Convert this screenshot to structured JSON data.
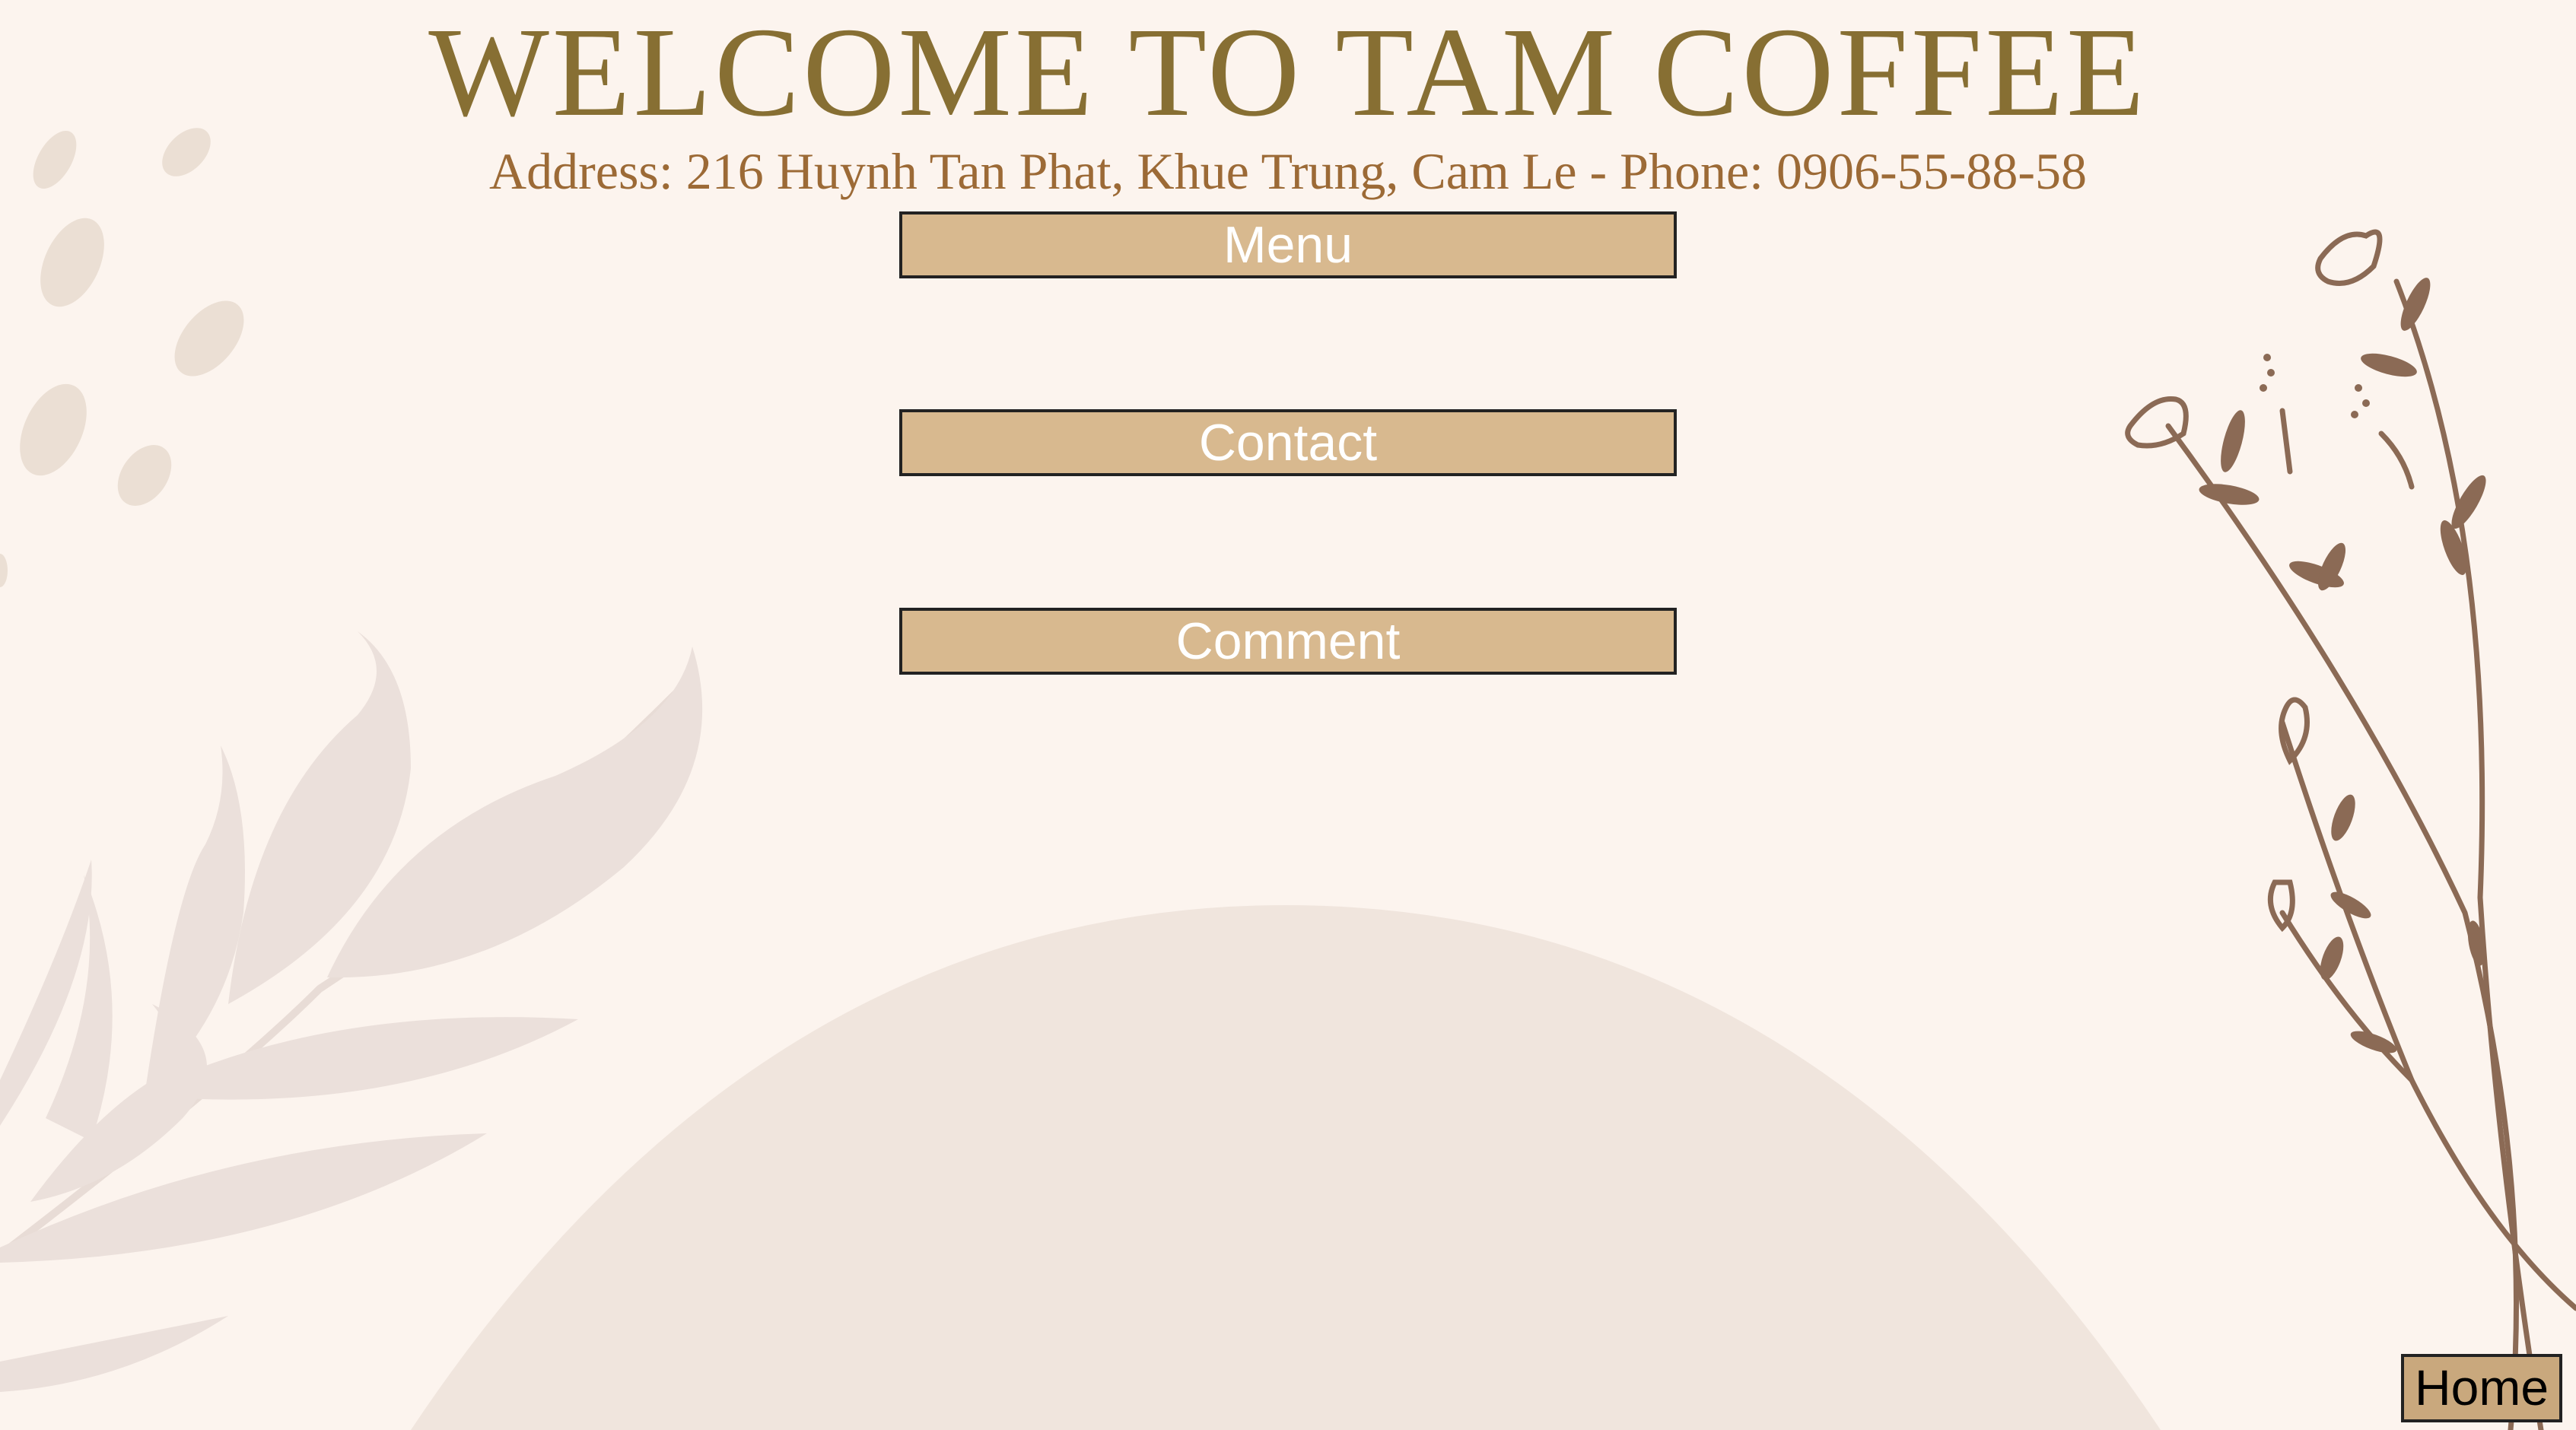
{
  "header": {
    "title": "WELCOME TO TAM COFFEE",
    "address": "Address: 216 Huynh Tan Phat, Khue Trung, Cam Le - Phone: 0906-55-88-58"
  },
  "nav": {
    "menu_label": "Menu",
    "contact_label": "Contact",
    "comment_label": "Comment"
  },
  "footer": {
    "home_label": "Home"
  },
  "colors": {
    "background": "#fcf4ee",
    "title": "#876f33",
    "address": "#9c6a36",
    "button": "#d8b98f",
    "home_button": "#c9a87d",
    "decor_leaf": "#ebe0db",
    "decor_flower": "#8b6a55"
  }
}
